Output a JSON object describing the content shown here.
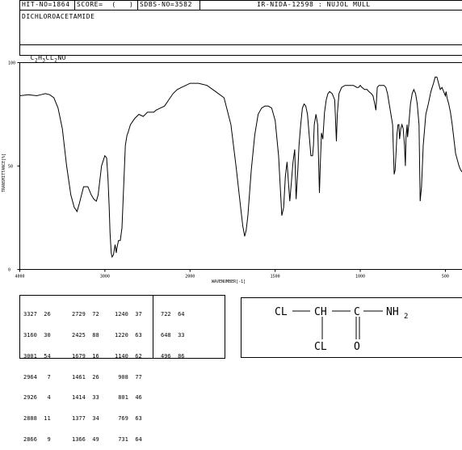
{
  "header": {
    "hit_no": "HIT-NO=1864",
    "score": "SCORE=  (   )",
    "sdbs_no": "SDBS-NO=3582",
    "ir_id": "IR-NIDA-12598 : NUJOL MULL"
  },
  "compound": {
    "name": "DICHLOROACETAMIDE",
    "formula_parts": [
      "C",
      "2",
      "H",
      "3",
      "CL",
      "2",
      "NO"
    ]
  },
  "structure": {
    "labels": [
      "CL",
      "CH",
      "C",
      "NH",
      "2",
      "CL",
      "O"
    ]
  },
  "chart_data": {
    "type": "line",
    "xlabel": "WAVENUMBER[-1]",
    "ylabel": "TRANSMITTANCE[%]",
    "xlim": [
      4000,
      400
    ],
    "ylim": [
      0,
      100
    ],
    "x_ticks": [
      "4000",
      "3000",
      "2000",
      "1500",
      "1000",
      "500"
    ],
    "y_ticks": [
      "100",
      "50",
      "0"
    ],
    "x_scale": "IR: linear 4000-2000, 2x expanded 2000-400",
    "series": [
      {
        "points": [
          [
            4000,
            84
          ],
          [
            3900,
            84.5
          ],
          [
            3800,
            84
          ],
          [
            3750,
            84.5
          ],
          [
            3700,
            85
          ],
          [
            3650,
            84.5
          ],
          [
            3600,
            83
          ],
          [
            3550,
            78
          ],
          [
            3500,
            68
          ],
          [
            3450,
            50
          ],
          [
            3400,
            36
          ],
          [
            3360,
            30
          ],
          [
            3327,
            28
          ],
          [
            3300,
            32
          ],
          [
            3250,
            40
          ],
          [
            3200,
            40
          ],
          [
            3160,
            36
          ],
          [
            3130,
            34
          ],
          [
            3100,
            33
          ],
          [
            3080,
            36
          ],
          [
            3060,
            43
          ],
          [
            3040,
            50
          ],
          [
            3001,
            55
          ],
          [
            2980,
            54
          ],
          [
            2964,
            44
          ],
          [
            2950,
            30
          ],
          [
            2940,
            18
          ],
          [
            2926,
            8
          ],
          [
            2915,
            6
          ],
          [
            2900,
            7
          ],
          [
            2888,
            10
          ],
          [
            2880,
            12
          ],
          [
            2866,
            8
          ],
          [
            2860,
            10
          ],
          [
            2840,
            14
          ],
          [
            2820,
            14
          ],
          [
            2800,
            20
          ],
          [
            2780,
            40
          ],
          [
            2760,
            60
          ],
          [
            2740,
            65
          ],
          [
            2729,
            66
          ],
          [
            2700,
            70
          ],
          [
            2650,
            73
          ],
          [
            2600,
            75
          ],
          [
            2550,
            74
          ],
          [
            2500,
            76
          ],
          [
            2425,
            76
          ],
          [
            2400,
            77
          ],
          [
            2350,
            78
          ],
          [
            2300,
            79
          ],
          [
            2250,
            82
          ],
          [
            2200,
            85
          ],
          [
            2150,
            87
          ],
          [
            2100,
            88
          ],
          [
            2050,
            89
          ],
          [
            2000,
            90
          ],
          [
            1950,
            90
          ],
          [
            1900,
            89
          ],
          [
            1850,
            86
          ],
          [
            1800,
            83
          ],
          [
            1760,
            70
          ],
          [
            1730,
            50
          ],
          [
            1700,
            28
          ],
          [
            1690,
            21
          ],
          [
            1679,
            16
          ],
          [
            1670,
            19
          ],
          [
            1660,
            26
          ],
          [
            1640,
            48
          ],
          [
            1620,
            65
          ],
          [
            1600,
            75
          ],
          [
            1580,
            78
          ],
          [
            1560,
            79
          ],
          [
            1540,
            79
          ],
          [
            1520,
            78
          ],
          [
            1500,
            72
          ],
          [
            1480,
            55
          ],
          [
            1461,
            26
          ],
          [
            1450,
            30
          ],
          [
            1440,
            45
          ],
          [
            1430,
            52
          ],
          [
            1420,
            40
          ],
          [
            1414,
            33
          ],
          [
            1405,
            42
          ],
          [
            1395,
            52
          ],
          [
            1385,
            58
          ],
          [
            1377,
            34
          ],
          [
            1370,
            44
          ],
          [
            1366,
            49
          ],
          [
            1360,
            60
          ],
          [
            1350,
            70
          ],
          [
            1340,
            78
          ],
          [
            1330,
            80
          ],
          [
            1320,
            79
          ],
          [
            1310,
            75
          ],
          [
            1300,
            65
          ],
          [
            1290,
            55
          ],
          [
            1280,
            55
          ],
          [
            1275,
            60
          ],
          [
            1270,
            70
          ],
          [
            1260,
            75
          ],
          [
            1250,
            70
          ],
          [
            1240,
            37
          ],
          [
            1235,
            50
          ],
          [
            1228,
            66
          ],
          [
            1220,
            63
          ],
          [
            1210,
            76
          ],
          [
            1200,
            82
          ],
          [
            1190,
            85
          ],
          [
            1180,
            86
          ],
          [
            1165,
            85
          ],
          [
            1150,
            82
          ],
          [
            1140,
            62
          ],
          [
            1135,
            75
          ],
          [
            1125,
            85
          ],
          [
            1110,
            88
          ],
          [
            1090,
            89
          ],
          [
            1060,
            89
          ],
          [
            1040,
            89
          ],
          [
            1020,
            88
          ],
          [
            1010,
            88
          ],
          [
            1000,
            89
          ],
          [
            990,
            88
          ],
          [
            975,
            87
          ],
          [
            960,
            87
          ],
          [
            950,
            86
          ],
          [
            935,
            85
          ],
          [
            925,
            84
          ],
          [
            915,
            80
          ],
          [
            908,
            77
          ],
          [
            900,
            88
          ],
          [
            890,
            89
          ],
          [
            880,
            89
          ],
          [
            870,
            89
          ],
          [
            860,
            89
          ],
          [
            850,
            88
          ],
          [
            840,
            85
          ],
          [
            830,
            80
          ],
          [
            820,
            75
          ],
          [
            810,
            70
          ],
          [
            801,
            46
          ],
          [
            795,
            48
          ],
          [
            790,
            56
          ],
          [
            785,
            65
          ],
          [
            778,
            70
          ],
          [
            773,
            70
          ],
          [
            769,
            63
          ],
          [
            762,
            68
          ],
          [
            755,
            70
          ],
          [
            748,
            68
          ],
          [
            740,
            60
          ],
          [
            735,
            50
          ],
          [
            731,
            64
          ],
          [
            725,
            70
          ],
          [
            722,
            64
          ],
          [
            715,
            70
          ],
          [
            705,
            80
          ],
          [
            695,
            85
          ],
          [
            685,
            87
          ],
          [
            675,
            85
          ],
          [
            665,
            80
          ],
          [
            655,
            70
          ],
          [
            648,
            33
          ],
          [
            640,
            40
          ],
          [
            630,
            60
          ],
          [
            615,
            75
          ],
          [
            600,
            80
          ],
          [
            585,
            86
          ],
          [
            570,
            90
          ],
          [
            560,
            93
          ],
          [
            550,
            93
          ],
          [
            540,
            90
          ],
          [
            530,
            87
          ],
          [
            520,
            88
          ],
          [
            510,
            86
          ],
          [
            500,
            84
          ],
          [
            496,
            86
          ],
          [
            490,
            83
          ],
          [
            480,
            80
          ],
          [
            470,
            76
          ],
          [
            460,
            70
          ],
          [
            450,
            63
          ],
          [
            440,
            56
          ],
          [
            430,
            53
          ],
          [
            420,
            50
          ],
          [
            410,
            48
          ],
          [
            400,
            47
          ]
        ]
      }
    ]
  },
  "peak_table": {
    "rows": [
      [
        "3327",
        "26",
        "2729",
        "72",
        "1240",
        "37",
        "722",
        "64"
      ],
      [
        "3160",
        "30",
        "2425",
        "88",
        "1220",
        "63",
        "648",
        "33"
      ],
      [
        "3001",
        "54",
        "1679",
        "16",
        "1140",
        "62",
        "496",
        "86"
      ],
      [
        "2964",
        "7",
        "1461",
        "26",
        "908",
        "77",
        "",
        ""
      ],
      [
        "2926",
        "4",
        "1414",
        "33",
        "801",
        "46",
        "",
        ""
      ],
      [
        "2888",
        "11",
        "1377",
        "34",
        "769",
        "63",
        "",
        ""
      ],
      [
        "2866",
        "9",
        "1366",
        "49",
        "731",
        "64",
        "",
        ""
      ]
    ]
  }
}
